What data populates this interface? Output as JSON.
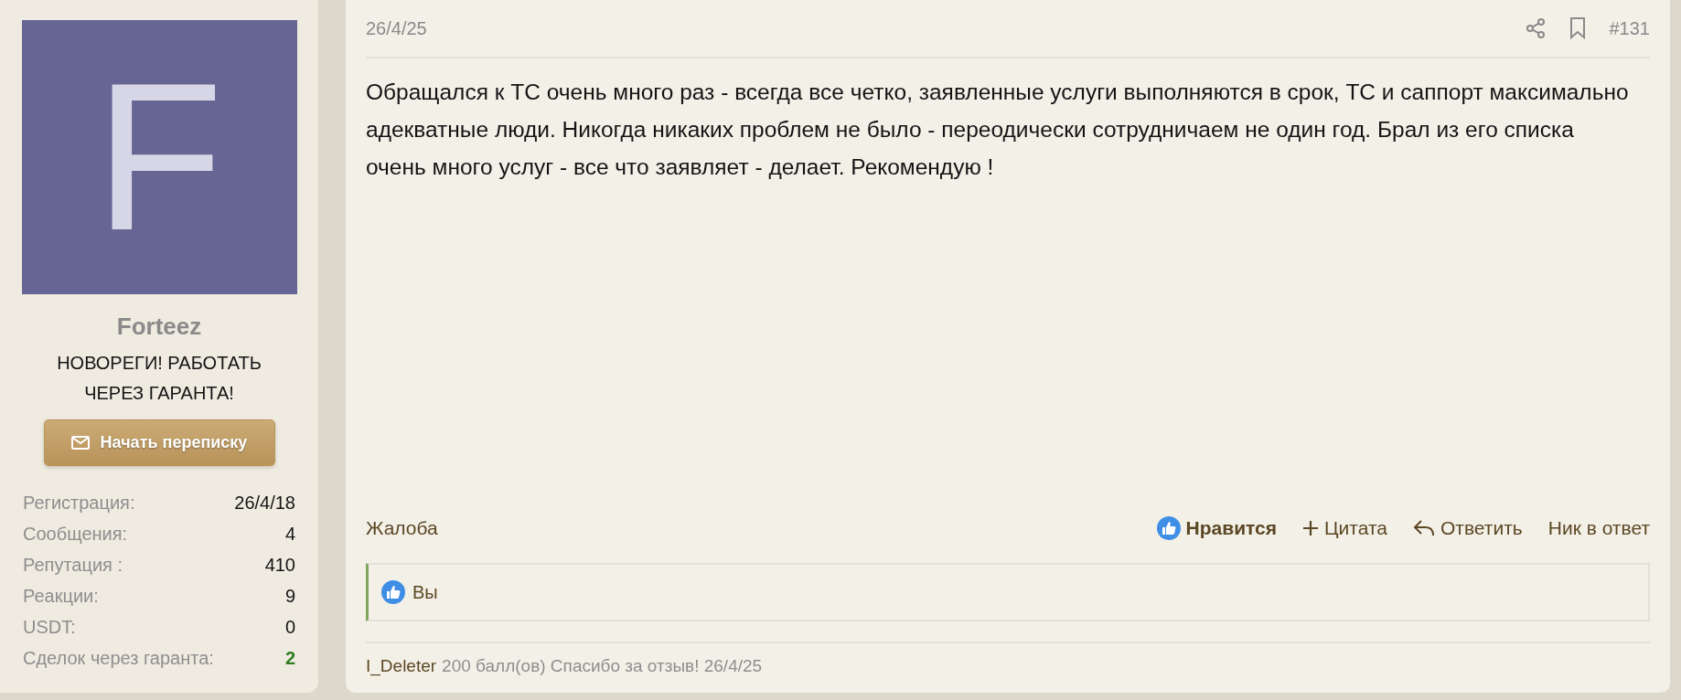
{
  "author": {
    "avatar_letter": "F",
    "name": "Forteez",
    "title": "НОВОРЕГИ! РАБОТАТЬ ЧЕРЕЗ ГАРАНТА!",
    "button": "Начать переписку",
    "stats": [
      {
        "label": "Регистрация:",
        "value": "26/4/18",
        "highlight": false
      },
      {
        "label": "Сообщения:",
        "value": "4",
        "highlight": false
      },
      {
        "label": "Репутация :",
        "value": "410",
        "highlight": false
      },
      {
        "label": "Реакции:",
        "value": "9",
        "highlight": false
      },
      {
        "label": "USDT:",
        "value": "0",
        "highlight": false
      },
      {
        "label": "Сделок через гаранта:",
        "value": "2",
        "highlight": true
      }
    ]
  },
  "post": {
    "date": "26/4/25",
    "number": "#131",
    "body": "Обращался к ТС очень много раз - всегда все четко, заявленные услуги выполняются в срок, ТС и саппорт максимально адекватные люди. Никогда никаких проблем не было - переодически сотрудничаем не один год. Брал из его списка очень много услуг - все что заявляет - делает. Рекомендую !",
    "report": "Жалоба",
    "actions": [
      {
        "kind": "like",
        "label": "Нравится",
        "liked": true
      },
      {
        "kind": "quote",
        "label": "Цитата"
      },
      {
        "kind": "reply",
        "label": "Ответить"
      },
      {
        "kind": "mention",
        "label": "Ник в ответ"
      }
    ],
    "reactions": {
      "users": "Вы"
    },
    "rating": {
      "user": "I_Deleter",
      "text": "200 балл(ов) Спасибо за отзыв! 26/4/25"
    }
  }
}
